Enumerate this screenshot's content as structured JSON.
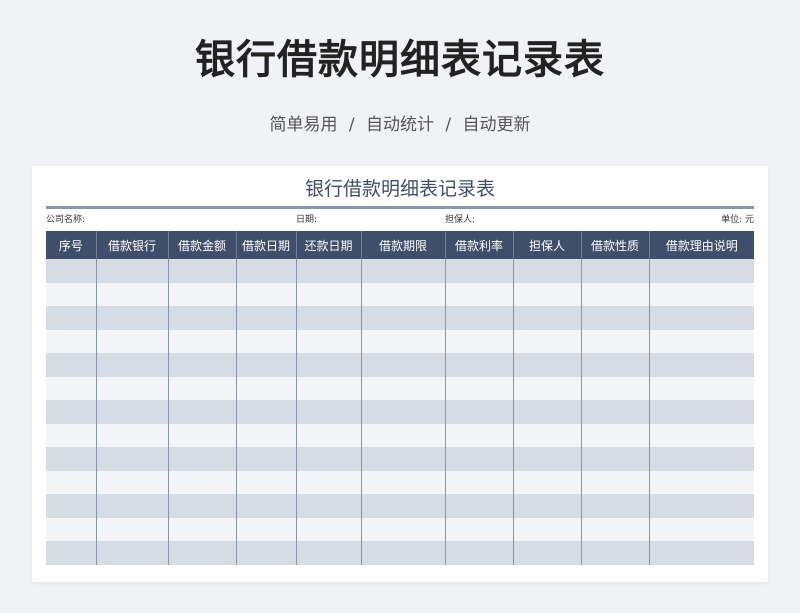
{
  "page": {
    "title": "银行借款明细表记录表",
    "subtitle": "简单易用 / 自动统计 / 自动更新"
  },
  "sheet": {
    "title": "银行借款明细表记录表",
    "company_label": "公司名称:",
    "date_label": "日期:",
    "guarantor_label": "担保人:",
    "unit_label": "单位: 元"
  },
  "table": {
    "columns": [
      "序号",
      "借款银行",
      "借款金额",
      "借款日期",
      "还款日期",
      "借款期限",
      "借款利率",
      "担保人",
      "借款性质",
      "借款理由说明"
    ],
    "row_count": 13
  },
  "colors": {
    "header_bg": "#3f4f6b",
    "row_stripe": "#d5dce4",
    "row_plain": "#f4f5f6"
  }
}
